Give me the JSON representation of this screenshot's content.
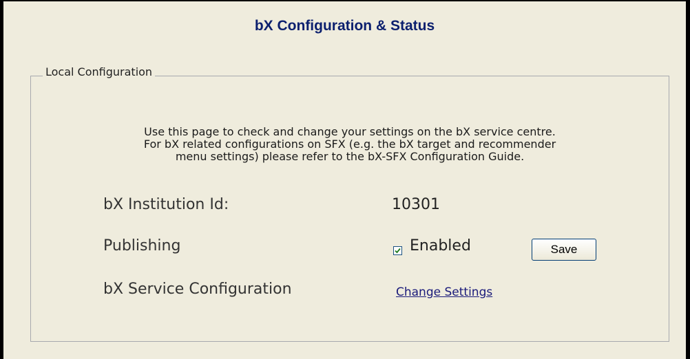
{
  "page": {
    "title": "bX Configuration & Status"
  },
  "local_configuration": {
    "legend": "Local Configuration",
    "intro_lines": [
      "Use this page to check and change your settings on the bX service centre.",
      "For bX related configurations on SFX (e.g. the bX target and recommender",
      "menu settings) please refer to the bX-SFX Configuration Guide."
    ],
    "institution_id_label": "bX Institution Id:",
    "institution_id_value": "10301",
    "publishing_label": "Publishing",
    "publishing_enabled": true,
    "enabled_label": "Enabled",
    "save_label": "Save",
    "service_config_label": "bX Service Configuration",
    "change_settings_label": "Change Settings"
  },
  "colors": {
    "background": "#efecdd",
    "title": "#0b1f6e",
    "link": "#1a1a7a",
    "fieldset_border": "#a7a9ae"
  },
  "icons": {
    "checkbox": "checkbox-checked-icon"
  }
}
